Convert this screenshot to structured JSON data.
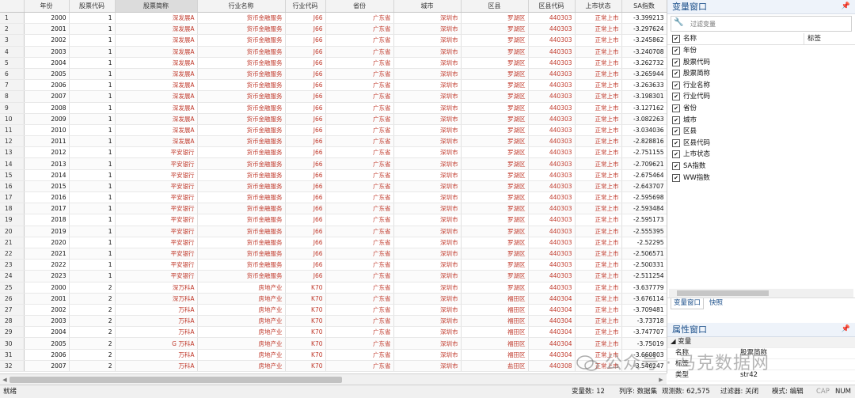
{
  "grid": {
    "columns": [
      "年份",
      "股票代码",
      "股票简称",
      "行业名称",
      "行业代码",
      "省份",
      "城市",
      "区县",
      "区县代码",
      "上市状态",
      "SA指数"
    ],
    "rows": [
      [
        "1",
        "2000",
        "1",
        "深发展A",
        "货币金融服务",
        "J66",
        "广东省",
        "深圳市",
        "罗湖区",
        "440303",
        "正常上市",
        "-3.399213"
      ],
      [
        "2",
        "2001",
        "1",
        "深发展A",
        "货币金融服务",
        "J66",
        "广东省",
        "深圳市",
        "罗湖区",
        "440303",
        "正常上市",
        "-3.297624"
      ],
      [
        "3",
        "2002",
        "1",
        "深发展A",
        "货币金融服务",
        "J66",
        "广东省",
        "深圳市",
        "罗湖区",
        "440303",
        "正常上市",
        "-3.245862"
      ],
      [
        "4",
        "2003",
        "1",
        "深发展A",
        "货币金融服务",
        "J66",
        "广东省",
        "深圳市",
        "罗湖区",
        "440303",
        "正常上市",
        "-3.240708"
      ],
      [
        "5",
        "2004",
        "1",
        "深发展A",
        "货币金融服务",
        "J66",
        "广东省",
        "深圳市",
        "罗湖区",
        "440303",
        "正常上市",
        "-3.262732"
      ],
      [
        "6",
        "2005",
        "1",
        "深发展A",
        "货币金融服务",
        "J66",
        "广东省",
        "深圳市",
        "罗湖区",
        "440303",
        "正常上市",
        "-3.265944"
      ],
      [
        "7",
        "2006",
        "1",
        "深发展A",
        "货币金融服务",
        "J66",
        "广东省",
        "深圳市",
        "罗湖区",
        "440303",
        "正常上市",
        "-3.263633"
      ],
      [
        "8",
        "2007",
        "1",
        "深发展A",
        "货币金融服务",
        "J66",
        "广东省",
        "深圳市",
        "罗湖区",
        "440303",
        "正常上市",
        "-3.198301"
      ],
      [
        "9",
        "2008",
        "1",
        "深发展A",
        "货币金融服务",
        "J66",
        "广东省",
        "深圳市",
        "罗湖区",
        "440303",
        "正常上市",
        "-3.127162"
      ],
      [
        "10",
        "2009",
        "1",
        "深发展A",
        "货币金融服务",
        "J66",
        "广东省",
        "深圳市",
        "罗湖区",
        "440303",
        "正常上市",
        "-3.082263"
      ],
      [
        "11",
        "2010",
        "1",
        "深发展A",
        "货币金融服务",
        "J66",
        "广东省",
        "深圳市",
        "罗湖区",
        "440303",
        "正常上市",
        "-3.034036"
      ],
      [
        "12",
        "2011",
        "1",
        "深发展A",
        "货币金融服务",
        "J66",
        "广东省",
        "深圳市",
        "罗湖区",
        "440303",
        "正常上市",
        "-2.828816"
      ],
      [
        "13",
        "2012",
        "1",
        "平安银行",
        "货币金融服务",
        "J66",
        "广东省",
        "深圳市",
        "罗湖区",
        "440303",
        "正常上市",
        "-2.751155"
      ],
      [
        "14",
        "2013",
        "1",
        "平安银行",
        "货币金融服务",
        "J66",
        "广东省",
        "深圳市",
        "罗湖区",
        "440303",
        "正常上市",
        "-2.709621"
      ],
      [
        "15",
        "2014",
        "1",
        "平安银行",
        "货币金融服务",
        "J66",
        "广东省",
        "深圳市",
        "罗湖区",
        "440303",
        "正常上市",
        "-2.675464"
      ],
      [
        "16",
        "2015",
        "1",
        "平安银行",
        "货币金融服务",
        "J66",
        "广东省",
        "深圳市",
        "罗湖区",
        "440303",
        "正常上市",
        "-2.643707"
      ],
      [
        "17",
        "2016",
        "1",
        "平安银行",
        "货币金融服务",
        "J66",
        "广东省",
        "深圳市",
        "罗湖区",
        "440303",
        "正常上市",
        "-2.595698"
      ],
      [
        "18",
        "2017",
        "1",
        "平安银行",
        "货币金融服务",
        "J66",
        "广东省",
        "深圳市",
        "罗湖区",
        "440303",
        "正常上市",
        "-2.593484"
      ],
      [
        "19",
        "2018",
        "1",
        "平安银行",
        "货币金融服务",
        "J66",
        "广东省",
        "深圳市",
        "罗湖区",
        "440303",
        "正常上市",
        "-2.595173"
      ],
      [
        "20",
        "2019",
        "1",
        "平安银行",
        "货币金融服务",
        "J66",
        "广东省",
        "深圳市",
        "罗湖区",
        "440303",
        "正常上市",
        "-2.555395"
      ],
      [
        "21",
        "2020",
        "1",
        "平安银行",
        "货币金融服务",
        "J66",
        "广东省",
        "深圳市",
        "罗湖区",
        "440303",
        "正常上市",
        "-2.52295"
      ],
      [
        "22",
        "2021",
        "1",
        "平安银行",
        "货币金融服务",
        "J66",
        "广东省",
        "深圳市",
        "罗湖区",
        "440303",
        "正常上市",
        "-2.506571"
      ],
      [
        "23",
        "2022",
        "1",
        "平安银行",
        "货币金融服务",
        "J66",
        "广东省",
        "深圳市",
        "罗湖区",
        "440303",
        "正常上市",
        "-2.500331"
      ],
      [
        "24",
        "2023",
        "1",
        "平安银行",
        "货币金融服务",
        "J66",
        "广东省",
        "深圳市",
        "罗湖区",
        "440303",
        "正常上市",
        "-2.511254"
      ],
      [
        "25",
        "2000",
        "2",
        "深万科A",
        "房地产业",
        "K70",
        "广东省",
        "深圳市",
        "罗湖区",
        "440303",
        "正常上市",
        "-3.637779"
      ],
      [
        "26",
        "2001",
        "2",
        "深万科A",
        "房地产业",
        "K70",
        "广东省",
        "深圳市",
        "福田区",
        "440304",
        "正常上市",
        "-3.676114"
      ],
      [
        "27",
        "2002",
        "2",
        "万科A",
        "房地产业",
        "K70",
        "广东省",
        "深圳市",
        "福田区",
        "440304",
        "正常上市",
        "-3.709481"
      ],
      [
        "28",
        "2003",
        "2",
        "万科A",
        "房地产业",
        "K70",
        "广东省",
        "深圳市",
        "福田区",
        "440304",
        "正常上市",
        "-3.73718"
      ],
      [
        "29",
        "2004",
        "2",
        "万科A",
        "房地产业",
        "K70",
        "广东省",
        "深圳市",
        "福田区",
        "440304",
        "正常上市",
        "-3.747707"
      ],
      [
        "30",
        "2005",
        "2",
        "G 万科A",
        "房地产业",
        "K70",
        "广东省",
        "深圳市",
        "福田区",
        "440304",
        "正常上市",
        "-3.75019"
      ],
      [
        "31",
        "2006",
        "2",
        "万科A",
        "房地产业",
        "K70",
        "广东省",
        "深圳市",
        "福田区",
        "440304",
        "正常上市",
        "-3.660803"
      ],
      [
        "32",
        "2007",
        "2",
        "万科A",
        "房地产业",
        "K70",
        "广东省",
        "深圳市",
        "盐田区",
        "440308",
        "正常上市",
        "-3.546247"
      ]
    ]
  },
  "variables_panel": {
    "title": "变量窗口",
    "filter_placeholder": "过滤变量",
    "header_name": "名称",
    "header_label": "标签",
    "items": [
      "年份",
      "股票代码",
      "股票简称",
      "行业名称",
      "行业代码",
      "省份",
      "城市",
      "区县",
      "区县代码",
      "上市状态",
      "SA指数",
      "WW指数"
    ],
    "tab_variables": "变量窗口",
    "tab_snapshot": "快照"
  },
  "properties_panel": {
    "title": "属性窗口",
    "group": "变量",
    "rows": [
      {
        "key": "名称",
        "value": "股票简称"
      },
      {
        "key": "标签",
        "value": ""
      },
      {
        "key": "类型",
        "value": "str42"
      }
    ]
  },
  "watermark": "公众号 · 马克数据网",
  "status": {
    "ready": "就绪",
    "var_count": "变量数: 12",
    "sort": "列序: 数据集",
    "obs": "观测数: 62,575",
    "filter": "过滤器: 关闭",
    "mode": "模式: 编辑",
    "cap": "CAP",
    "num": "NUM"
  }
}
